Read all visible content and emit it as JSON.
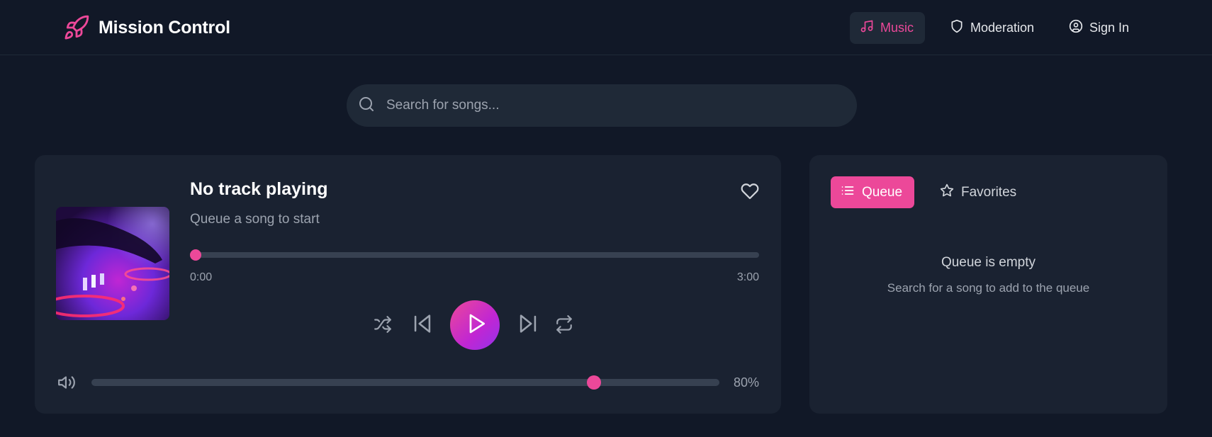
{
  "header": {
    "title": "Mission Control",
    "nav": {
      "music": "Music",
      "moderation": "Moderation",
      "sign_in": "Sign In"
    },
    "active_nav": "Music"
  },
  "search": {
    "placeholder": "Search for songs...",
    "value": ""
  },
  "player": {
    "title": "No track playing",
    "subtitle": "Queue a song to start",
    "time_current": "0:00",
    "time_total": "3:00",
    "progress_fraction": 0.0,
    "playing": false,
    "volume_label": "80%",
    "volume_fraction": 0.8,
    "favorited": false
  },
  "queue_panel": {
    "tabs": {
      "queue": "Queue",
      "favorites": "Favorites"
    },
    "active_tab": "Queue",
    "empty_title": "Queue is empty",
    "empty_subtitle": "Search for a song to add to the queue"
  },
  "icons": {
    "brand": "rocket-icon",
    "music": "music-note-icon",
    "moderation": "shield-icon",
    "sign_in": "user-circle-icon",
    "search": "search-icon",
    "favorite": "heart-icon",
    "shuffle": "shuffle-icon",
    "previous": "skip-back-icon",
    "play": "play-icon",
    "next": "skip-forward-icon",
    "repeat": "repeat-icon",
    "volume": "volume-icon",
    "queue": "list-icon",
    "favorites": "star-icon"
  },
  "colors": {
    "accent": "#ec4899",
    "background": "#111827",
    "card": "#1a2231",
    "muted_text": "#9ca3af"
  }
}
